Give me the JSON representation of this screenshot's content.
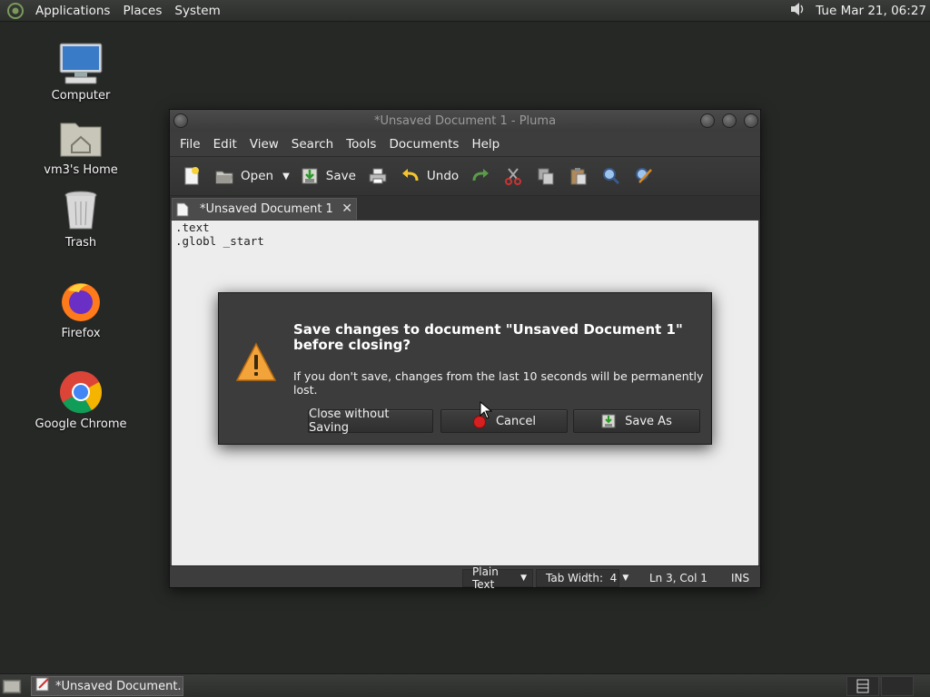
{
  "top_panel": {
    "menus": [
      "Applications",
      "Places",
      "System"
    ],
    "clock": "Tue Mar 21, 06:27",
    "icons": {
      "menu": "mate-logo-icon",
      "volume": "volume-icon"
    }
  },
  "desktop": {
    "icons": [
      {
        "label": "Computer",
        "icon": "computer-icon"
      },
      {
        "label": "vm3's Home",
        "icon": "home-folder-icon"
      },
      {
        "label": "Trash",
        "icon": "trash-icon"
      },
      {
        "label": "Firefox",
        "icon": "firefox-icon"
      },
      {
        "label": "Google Chrome",
        "icon": "chrome-icon"
      }
    ]
  },
  "window": {
    "title": "*Unsaved Document 1 - Pluma",
    "menus": [
      "File",
      "Edit",
      "View",
      "Search",
      "Tools",
      "Documents",
      "Help"
    ],
    "toolbar": {
      "open_label": "Open",
      "save_label": "Save",
      "undo_label": "Undo"
    },
    "tab": {
      "label": "*Unsaved Document 1",
      "close": "✕"
    },
    "editor": {
      "lines": [
        ".text",
        ".globl _start"
      ]
    },
    "status": {
      "language": "Plain Text",
      "tab_width": "Tab Width:  4",
      "position": "Ln 3, Col 1",
      "mode": "INS"
    }
  },
  "dialog": {
    "title": "Save changes to document \"Unsaved Document 1\" before closing?",
    "message": "If you don't save, changes from the last 10 seconds will be permanently lost.",
    "buttons": {
      "close_without_saving": "Close without Saving",
      "cancel": "Cancel",
      "save_as": "Save As"
    }
  },
  "bottom_panel": {
    "task_label": "*Unsaved Document..."
  },
  "colors": {
    "desktop_bg": "#262826",
    "editor_bg": "#ededed",
    "dialog_bg": "#3b3c3b"
  }
}
